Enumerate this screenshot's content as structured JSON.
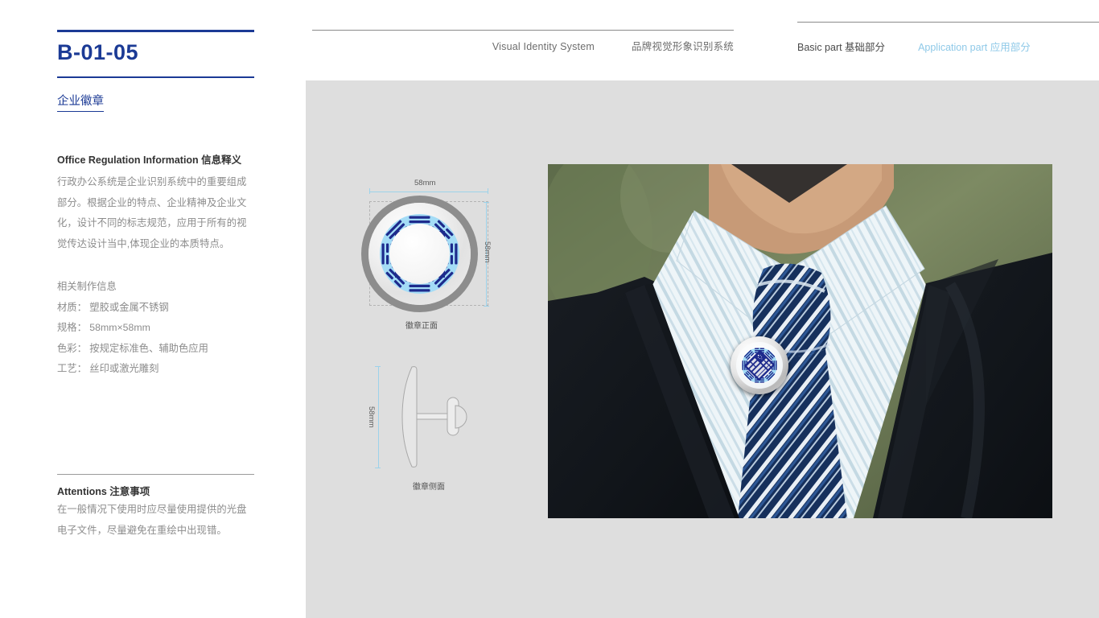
{
  "header": {
    "system_en": "Visual Identity System",
    "system_cn": "品牌视觉形象识别系统",
    "nav_basic": "Basic part 基础部分",
    "nav_application": "Application part 应用部分",
    "accent_navy": "#1b3a95",
    "accent_light_blue": "#8fc9e8"
  },
  "sidebar": {
    "code": "B-01-05",
    "subtitle": "企业徽章",
    "info_heading": "Office Regulation Information  信息释义",
    "info_body": "行政办公系统是企业识别系统中的重要组成部分。根据企业的特点、企业精神及企业文化，设计不同的标志规范，应用于所有的视觉传达设计当中,体现企业的本质特点。",
    "spec_heading": "相关制作信息",
    "specs": [
      "材质： 塑胶或金属不锈钢",
      "规格： 58mm×58mm",
      "色彩： 按规定标准色、辅助色应用",
      "工艺： 丝印或激光雕刻"
    ],
    "attentions_heading": "Attentions 注意事项",
    "attentions_body": "在一般情况下使用时应尽量使用提供的光盘电子文件，尽量避免在重绘中出现错。"
  },
  "diagram": {
    "width_dimension": "58mm",
    "height_dimension": "58mm",
    "side_height_dimension": "58mm",
    "front_label": "徽章正面",
    "side_label": "徽章侧面",
    "badge_colors": {
      "emblem_navy": "#1d2a8c",
      "ring_gray": "#8d8d8d",
      "inner_blue": "#a4dcf6"
    }
  }
}
